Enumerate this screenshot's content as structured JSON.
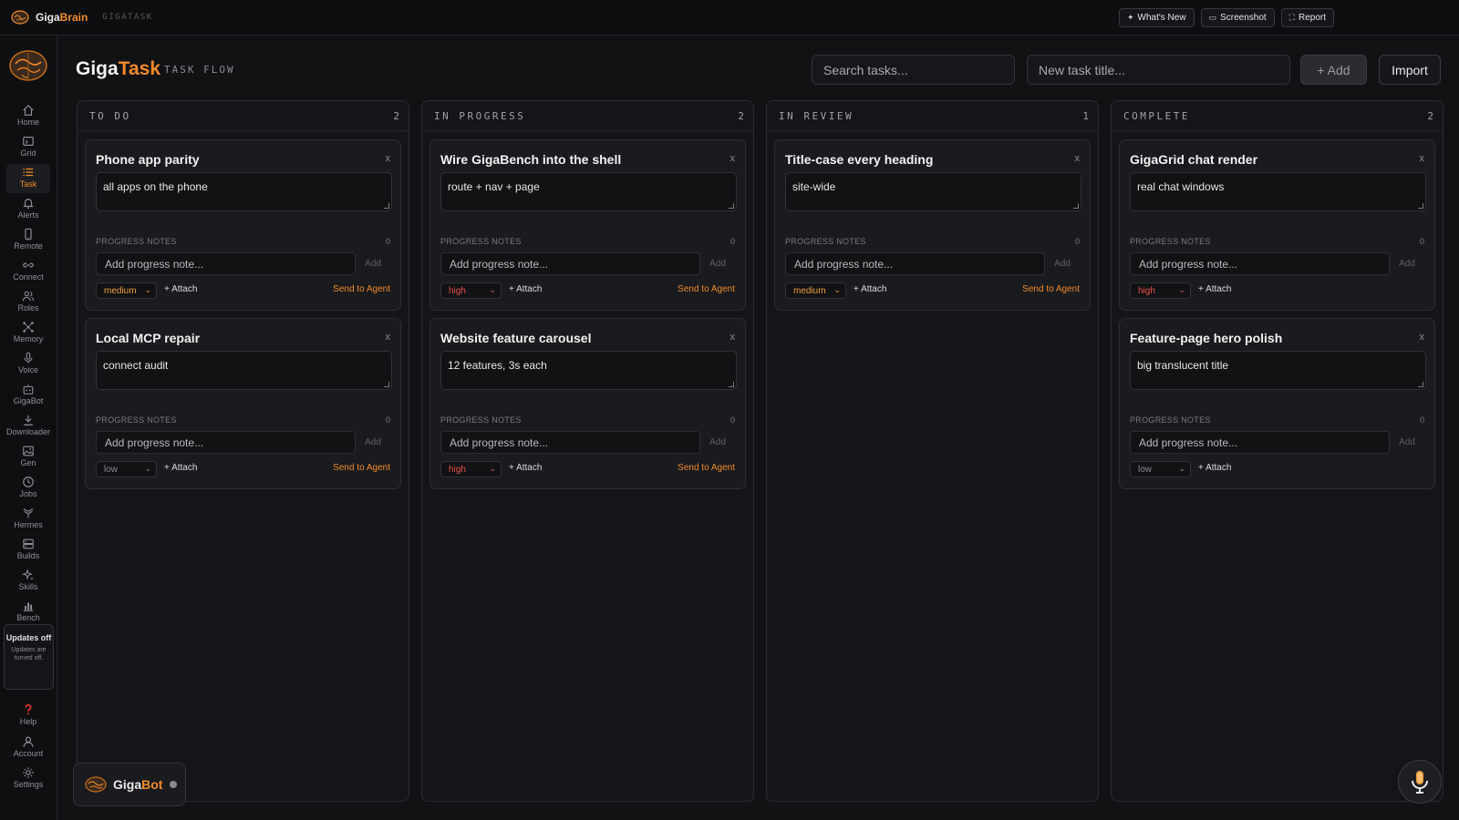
{
  "topbar": {
    "brand_prefix": "Giga",
    "brand_suffix": "Brain",
    "subtitle": "GIGATASK",
    "actions": [
      {
        "label": "What's New",
        "icon": "sparkle-icon"
      },
      {
        "label": "Screenshot",
        "icon": "screenshot-icon"
      },
      {
        "label": "Report",
        "icon": "report-icon"
      }
    ]
  },
  "sidebar": {
    "items": [
      {
        "label": "Home",
        "icon": "home-icon",
        "active": false
      },
      {
        "label": "Grid",
        "icon": "grid-icon",
        "active": false
      },
      {
        "label": "Task",
        "icon": "task-list-icon",
        "active": true
      },
      {
        "label": "Alerts",
        "icon": "bell-icon",
        "active": false
      },
      {
        "label": "Remote",
        "icon": "phone-icon",
        "active": false
      },
      {
        "label": "Connect",
        "icon": "link-icon",
        "active": false
      },
      {
        "label": "Roles",
        "icon": "users-icon",
        "active": false
      },
      {
        "label": "Memory",
        "icon": "network-icon",
        "active": false
      },
      {
        "label": "Voice",
        "icon": "mic-icon",
        "active": false
      },
      {
        "label": "GigaBot",
        "icon": "bot-icon",
        "active": false
      },
      {
        "label": "Downloader",
        "icon": "download-icon",
        "active": false
      },
      {
        "label": "Gen",
        "icon": "image-icon",
        "active": false
      },
      {
        "label": "Jobs",
        "icon": "clock-icon",
        "active": false
      },
      {
        "label": "Hermes",
        "icon": "hermes-icon",
        "active": false
      },
      {
        "label": "Builds",
        "icon": "server-icon",
        "active": false
      },
      {
        "label": "Skills",
        "icon": "sparkle-icon",
        "active": false
      },
      {
        "label": "Bench",
        "icon": "chart-icon",
        "active": false
      }
    ],
    "updates": {
      "title": "Updates off",
      "desc": "Updates are turned off."
    },
    "bottom_items": [
      {
        "label": "Help",
        "icon": "help-icon"
      },
      {
        "label": "Account",
        "icon": "account-icon"
      },
      {
        "label": "Settings",
        "icon": "gear-icon"
      }
    ]
  },
  "header": {
    "title_prefix": "Giga",
    "title_suffix": "Task",
    "subtitle": "TASK FLOW",
    "search_placeholder": "Search tasks...",
    "new_task_placeholder": "New task title...",
    "add_label": "+ Add",
    "import_label": "Import"
  },
  "card_labels": {
    "progress_notes": "PROGRESS NOTES",
    "note_placeholder": "Add progress note...",
    "note_add": "Add",
    "attach": "+ Attach",
    "send_to_agent": "Send to Agent",
    "close": "x"
  },
  "columns": [
    {
      "title": "TO DO",
      "count": "2",
      "cards": [
        {
          "title": "Phone app parity",
          "desc": "all apps on the phone",
          "notes_count": "0",
          "priority": "medium",
          "send": true
        },
        {
          "title": "Local MCP repair",
          "desc": "connect audit",
          "notes_count": "0",
          "priority": "low",
          "send": true
        }
      ]
    },
    {
      "title": "IN PROGRESS",
      "count": "2",
      "cards": [
        {
          "title": "Wire GigaBench into the shell",
          "desc": "route + nav + page",
          "notes_count": "0",
          "priority": "high",
          "send": true
        },
        {
          "title": "Website feature carousel",
          "desc": "12 features, 3s each",
          "notes_count": "0",
          "priority": "high",
          "send": true
        }
      ]
    },
    {
      "title": "IN REVIEW",
      "count": "1",
      "cards": [
        {
          "title": "Title-case every heading",
          "desc": "site-wide",
          "notes_count": "0",
          "priority": "medium",
          "send": true
        }
      ]
    },
    {
      "title": "COMPLETE",
      "count": "2",
      "cards": [
        {
          "title": "GigaGrid chat render",
          "desc": "real chat windows",
          "notes_count": "0",
          "priority": "high",
          "send": false
        },
        {
          "title": "Feature-page hero polish",
          "desc": "big translucent title",
          "notes_count": "0",
          "priority": "low",
          "send": false
        }
      ]
    }
  ],
  "gigabot": {
    "prefix": "Giga",
    "suffix": "Bot"
  },
  "colors": {
    "accent": "#f08a2c",
    "high": "#e8514b",
    "medium": "#f0a040",
    "low": "#8a8b8f"
  }
}
